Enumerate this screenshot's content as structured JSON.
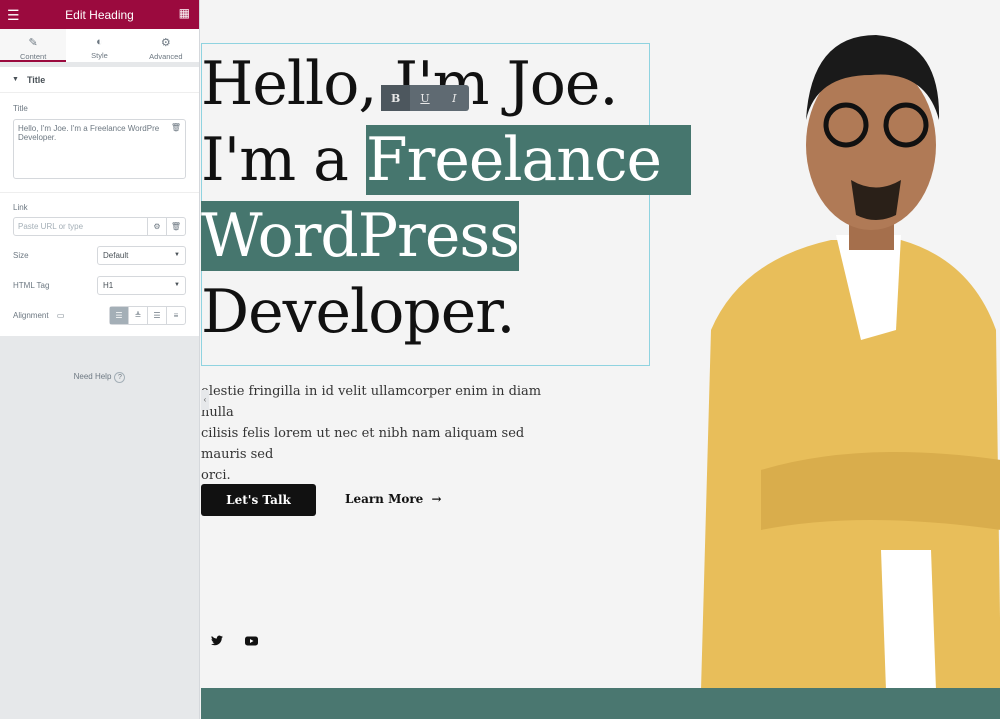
{
  "panel": {
    "title": "Edit Heading",
    "menu_icon": "hamburger-icon",
    "grid_icon": "grid-icon",
    "tabs": [
      {
        "label": "Content",
        "icon": "pencil-icon"
      },
      {
        "label": "Style",
        "icon": "half-circle-icon"
      },
      {
        "label": "Advanced",
        "icon": "gear-icon"
      }
    ],
    "section": "Title",
    "title_label": "Title",
    "title_value": "Hello, I'm Joe. I'm a Freelance WordPre\nDeveloper.",
    "link_label": "Link",
    "link_placeholder": "Paste URL or type",
    "size_label": "Size",
    "size_value": "Default",
    "tag_label": "HTML Tag",
    "tag_value": "H1",
    "align_label": "Alignment",
    "need_help": "Need Help",
    "help_icon": "?"
  },
  "preview": {
    "h_line1": "Hello, I'm Joe.",
    "h_line2a": "I'm a ",
    "h_line2b": "Freelance",
    "h_line3": "WordPress",
    "h_line4": "Developer.",
    "toolbar": {
      "bold": "B",
      "underline": "U",
      "italic": "I"
    },
    "para1": "olestie fringilla in id velit ullamcorper enim in diam nulla",
    "para2": "cilisis felis lorem ut nec et nibh nam aliquam sed mauris sed",
    "para3": "orci.",
    "cta": "Let's Talk",
    "learn": "Learn More",
    "arrow": "→"
  },
  "colors": {
    "brand": "#9b0a3e",
    "highlight": "#46766e",
    "footer": "#4a7770"
  }
}
